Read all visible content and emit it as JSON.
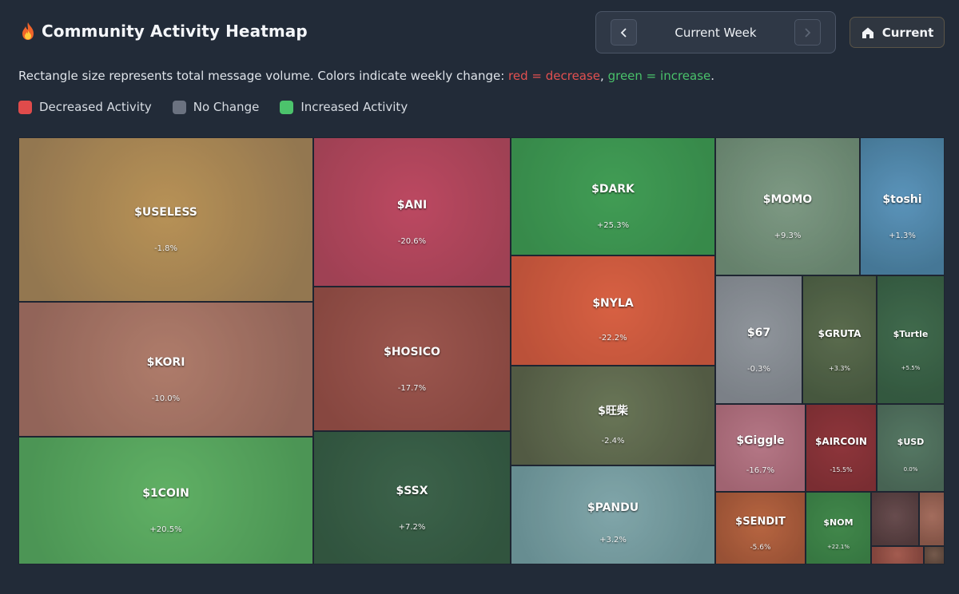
{
  "header": {
    "title": "Community Activity Heatmap",
    "icon": "fire-icon"
  },
  "week_nav": {
    "label": "Current Week",
    "prev_icon": "chevron-left-icon",
    "next_icon": "chevron-right-icon"
  },
  "current_button": {
    "label": "Current",
    "icon": "home-icon"
  },
  "description": {
    "prefix": "Rectangle size represents total message volume. Colors indicate weekly change: ",
    "red_text": "red = decrease",
    "separator": ", ",
    "green_text": "green = increase",
    "suffix": "."
  },
  "legend": [
    {
      "label": "Decreased Activity",
      "color": "#e04b4b"
    },
    {
      "label": "No Change",
      "color": "#6b7280"
    },
    {
      "label": "Increased Activity",
      "color": "#4cc36c"
    }
  ],
  "colors": {
    "background": "#222b38",
    "decrease": "#e25050",
    "increase": "#49c16a"
  },
  "chart_data": {
    "type": "heatmap",
    "size_meaning": "total message volume",
    "color_meaning": "weekly change",
    "items": [
      {
        "name": "$USELESS",
        "change": -1.8,
        "change_label": "-1.8%"
      },
      {
        "name": "$KORI",
        "change": -10.0,
        "change_label": "-10.0%"
      },
      {
        "name": "$1COIN",
        "change": 20.5,
        "change_label": "+20.5%"
      },
      {
        "name": "$ANI",
        "change": -20.6,
        "change_label": "-20.6%"
      },
      {
        "name": "$HOSICO",
        "change": -17.7,
        "change_label": "-17.7%"
      },
      {
        "name": "$SSX",
        "change": 7.2,
        "change_label": "+7.2%"
      },
      {
        "name": "$DARK",
        "change": 25.3,
        "change_label": "+25.3%"
      },
      {
        "name": "$NYLA",
        "change": -22.2,
        "change_label": "-22.2%"
      },
      {
        "name": "$旺柴",
        "change": -2.4,
        "change_label": "-2.4%"
      },
      {
        "name": "$PANDU",
        "change": 3.2,
        "change_label": "+3.2%"
      },
      {
        "name": "$MOMO",
        "change": 9.3,
        "change_label": "+9.3%"
      },
      {
        "name": "$toshi",
        "change": 1.3,
        "change_label": "+1.3%"
      },
      {
        "name": "$67",
        "change": -0.3,
        "change_label": "-0.3%"
      },
      {
        "name": "$GRUTA",
        "change": 3.3,
        "change_label": "+3.3%"
      },
      {
        "name": "$Turtle",
        "change": 5.5,
        "change_label": "+5.5%"
      },
      {
        "name": "$Giggle",
        "change": -16.7,
        "change_label": "-16.7%"
      },
      {
        "name": "$AIRCOIN",
        "change": -15.5,
        "change_label": "-15.5%"
      },
      {
        "name": "$USD",
        "change": 0.0,
        "change_label": "0.0%"
      },
      {
        "name": "$SENDIT",
        "change": -5.6,
        "change_label": "-5.6%"
      },
      {
        "name": "$NOM",
        "change": 22.1,
        "change_label": "+22.1%"
      },
      {
        "name": "",
        "change": null,
        "change_label": ""
      },
      {
        "name": "",
        "change": null,
        "change_label": ""
      },
      {
        "name": "",
        "change": null,
        "change_label": ""
      },
      {
        "name": "",
        "change": null,
        "change_label": ""
      }
    ]
  }
}
